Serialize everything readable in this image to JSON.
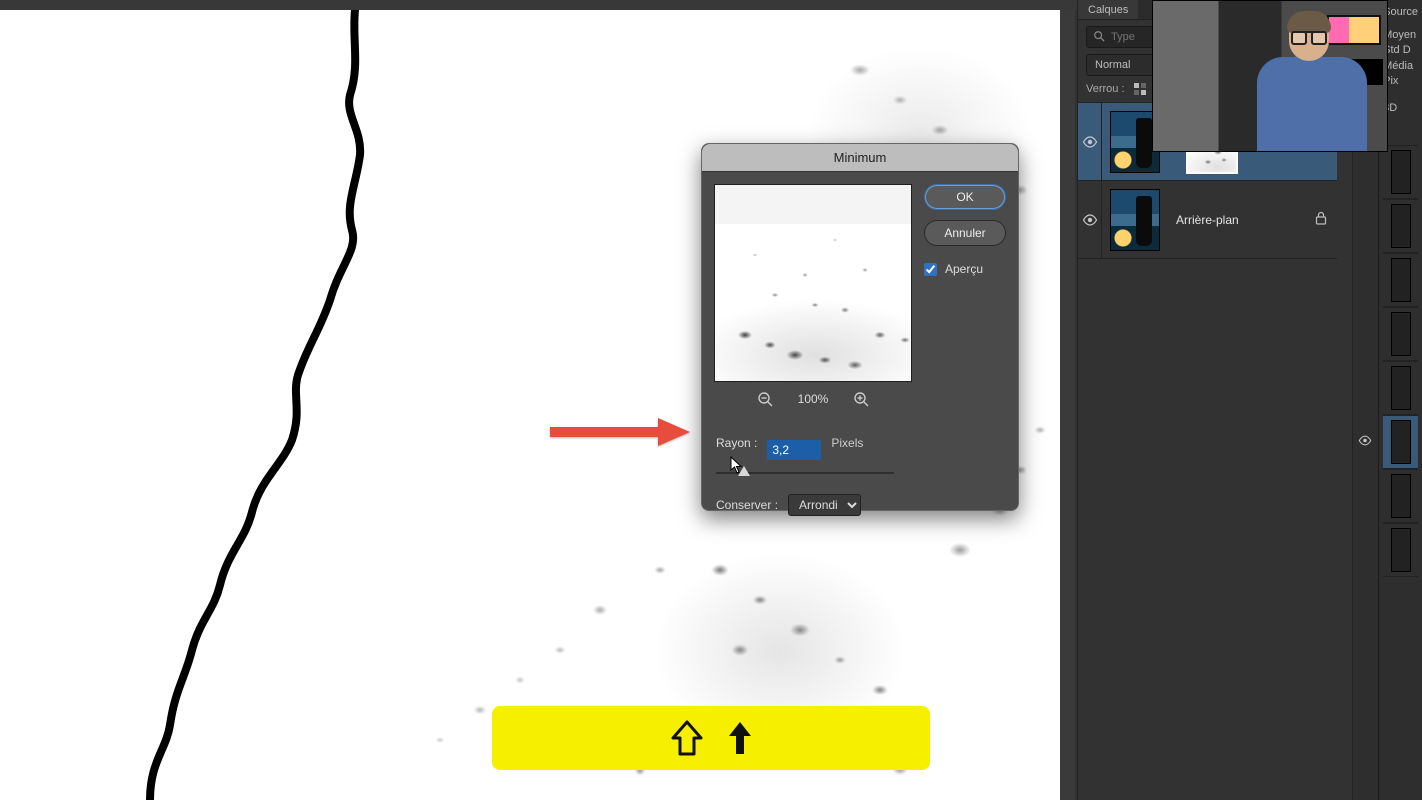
{
  "dialog": {
    "title": "Minimum",
    "ok": "OK",
    "cancel": "Annuler",
    "preview_checkbox": "Aperçu",
    "zoom_pct": "100%",
    "radius_label": "Rayon :",
    "radius_value": "3,2",
    "radius_unit": "Pixels",
    "preserve_label": "Conserver :",
    "preserve_value": "Arrondi"
  },
  "layers_panel": {
    "tab": "Calques",
    "search_placeholder": "Type",
    "blend_mode": "Normal",
    "lock_label": "Verrou :",
    "layers": [
      {
        "name": "",
        "has_mask": true
      },
      {
        "name": "Arrière-plan",
        "has_mask": false,
        "locked": true
      }
    ]
  },
  "side_panel": {
    "source_label": "Source",
    "stat_moyen": "Moyen",
    "stat_std": "Std D",
    "stat_median": "Média",
    "stat_pix": "Pix",
    "threeD": "3D"
  },
  "key_indicator": {
    "keys": "Shift + Up"
  },
  "colors": {
    "arrow": "#e74c3c",
    "key_bg": "#f6ef00",
    "selection": "#3a5a7a"
  }
}
